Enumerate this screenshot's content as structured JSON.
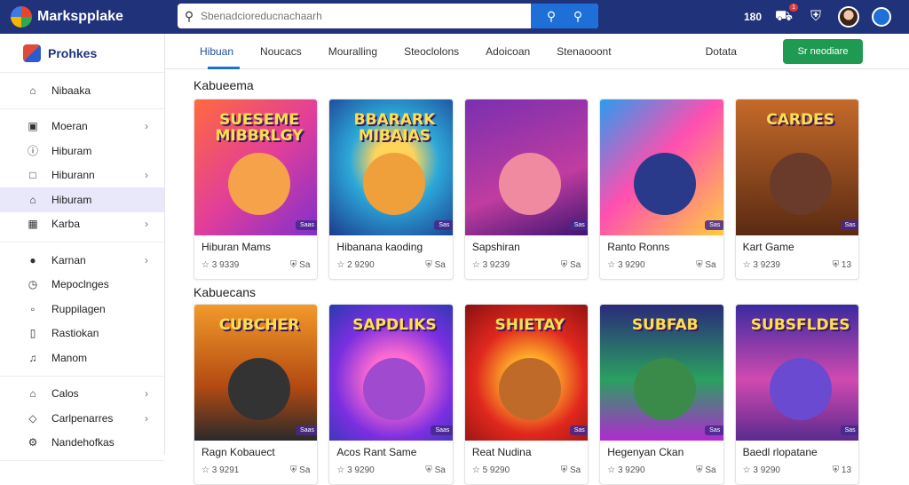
{
  "app": {
    "name": "Markspplake"
  },
  "search": {
    "placeholder": "Sbenadcioreducnachaarh"
  },
  "topbar": {
    "right_text": "180",
    "badge": "1"
  },
  "sidebar": {
    "header": "Prohkes",
    "groups": [
      [
        {
          "label": "Nibaaka",
          "icon": "home-icon",
          "chevron": false
        }
      ],
      [
        {
          "label": "Moeran",
          "icon": "bag-icon",
          "chevron": true
        },
        {
          "label": "Hiburam",
          "icon": "info-icon",
          "chevron": false
        },
        {
          "label": "Hiburann",
          "icon": "square-icon",
          "chevron": true
        },
        {
          "label": "Hiburam",
          "icon": "house-icon",
          "chevron": false,
          "active": true
        },
        {
          "label": "Karba",
          "icon": "grid-icon",
          "chevron": true
        }
      ],
      [
        {
          "label": "Karnan",
          "icon": "user-icon",
          "chevron": true
        },
        {
          "label": "Mepoclnges",
          "icon": "clock-icon",
          "chevron": false
        },
        {
          "label": "Ruppilagen",
          "icon": "doc-icon",
          "chevron": false
        },
        {
          "label": "Rastiokan",
          "icon": "page-icon",
          "chevron": false
        },
        {
          "label": "Manom",
          "icon": "music-icon",
          "chevron": false
        }
      ],
      [
        {
          "label": "Calos",
          "icon": "home-icon",
          "chevron": true
        },
        {
          "label": "Carlpenarres",
          "icon": "diamond-icon",
          "chevron": true
        },
        {
          "label": "Nandehofkas",
          "icon": "gear-icon",
          "chevron": false
        }
      ]
    ]
  },
  "tabs": [
    "Hibuan",
    "Noucacs",
    "Mouralling",
    "Steoclolons",
    "Adoicoan",
    "Stenaooont",
    "Dotata"
  ],
  "create_button": "Sr neodiare",
  "sections": [
    {
      "title": "Kabueema",
      "cards": [
        {
          "art": "SUESEME MIBBRLGY",
          "title": "Hiburan Mams",
          "rating": "3 9339",
          "tag": "Saas",
          "extra": "Sa"
        },
        {
          "art": "BBARARK MIBAIAS",
          "title": "Hibanana kaoding",
          "rating": "2 9290",
          "tag": "Sas",
          "extra": "Sa"
        },
        {
          "art": "",
          "title": "Sapshiran",
          "rating": "3 9239",
          "tag": "Sas",
          "extra": "Sa"
        },
        {
          "art": "",
          "title": "Ranto Ronns",
          "rating": "3 9290",
          "tag": "Sas",
          "extra": "Sa"
        },
        {
          "art": "CARDES",
          "title": "Kart Game",
          "rating": "3 9239",
          "tag": "Sas",
          "extra": "13"
        }
      ]
    },
    {
      "title": "Kabuecans",
      "cards": [
        {
          "art": "CUBCHER",
          "title": "Ragn Kobauect",
          "rating": "3 9291",
          "tag": "Saas",
          "extra": "Sa"
        },
        {
          "art": "SAPDLIKS",
          "title": "Acos Rant Same",
          "rating": "3 9290",
          "tag": "Saas",
          "extra": "Sa"
        },
        {
          "art": "SHIETAY",
          "title": "Reat Nudina",
          "rating": "5 9290",
          "tag": "Sas",
          "extra": "Sa"
        },
        {
          "art": "SUBFAB",
          "title": "Hegenyan Ckan",
          "rating": "3 9290",
          "tag": "Sas",
          "extra": "Sa"
        },
        {
          "art": "SUBSFLDES",
          "title": "Baedl rlopatane",
          "rating": "3 9290",
          "tag": "Sas",
          "extra": "13"
        }
      ]
    }
  ]
}
